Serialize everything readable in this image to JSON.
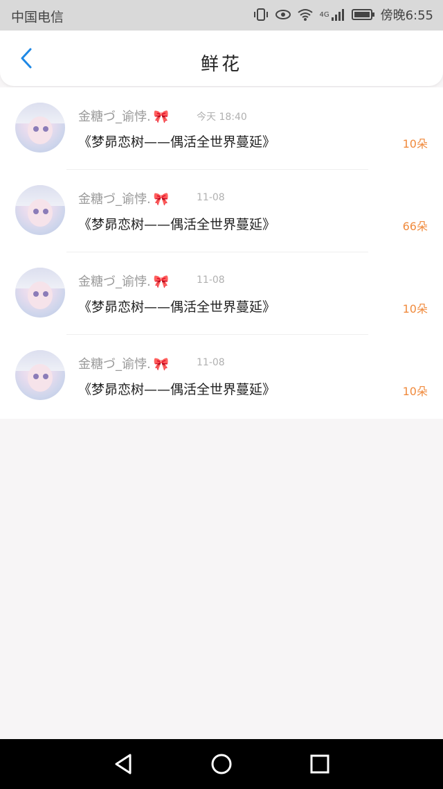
{
  "status_bar": {
    "carrier": "中国电信",
    "network": "4G",
    "time": "傍晚6:55"
  },
  "header": {
    "title": "鲜花",
    "back_icon": "chevron-left-icon"
  },
  "flowers": [
    {
      "name": "金糖づ_谕悖.",
      "date": "今天 18:40",
      "work": "《梦昴恋树——偶活全世界蔓延》",
      "count": "10朵"
    },
    {
      "name": "金糖づ_谕悖.",
      "date": "11-08",
      "work": "《梦昴恋树——偶活全世界蔓延》",
      "count": "66朵"
    },
    {
      "name": "金糖づ_谕悖.",
      "date": "11-08",
      "work": "《梦昴恋树——偶活全世界蔓延》",
      "count": "10朵"
    },
    {
      "name": "金糖づ_谕悖.",
      "date": "11-08",
      "work": "《梦昴恋树——偶活全世界蔓延》",
      "count": "10朵"
    }
  ],
  "colors": {
    "accent": "#1e88e5",
    "count": "#f08a3c"
  }
}
